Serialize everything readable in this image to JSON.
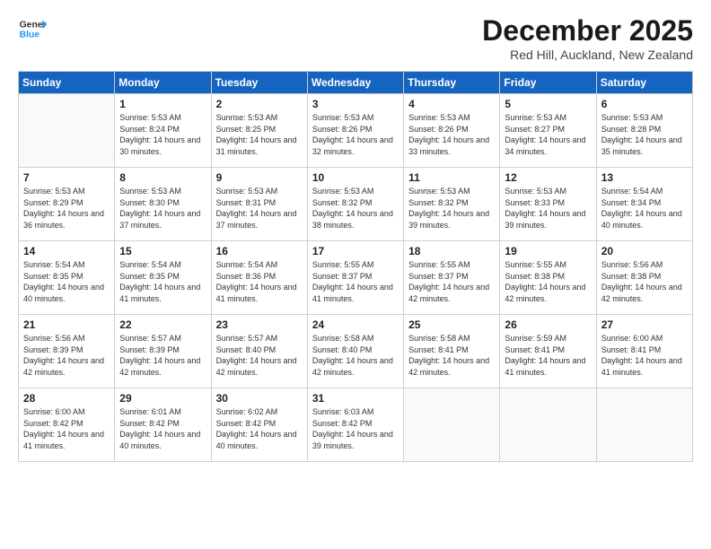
{
  "header": {
    "logo_general": "General",
    "logo_blue": "Blue",
    "month_title": "December 2025",
    "location": "Red Hill, Auckland, New Zealand"
  },
  "days_of_week": [
    "Sunday",
    "Monday",
    "Tuesday",
    "Wednesday",
    "Thursday",
    "Friday",
    "Saturday"
  ],
  "weeks": [
    [
      {
        "day": "",
        "info": "",
        "empty": true
      },
      {
        "day": "1",
        "info": "Sunrise: 5:53 AM\nSunset: 8:24 PM\nDaylight: 14 hours\nand 30 minutes."
      },
      {
        "day": "2",
        "info": "Sunrise: 5:53 AM\nSunset: 8:25 PM\nDaylight: 14 hours\nand 31 minutes."
      },
      {
        "day": "3",
        "info": "Sunrise: 5:53 AM\nSunset: 8:26 PM\nDaylight: 14 hours\nand 32 minutes."
      },
      {
        "day": "4",
        "info": "Sunrise: 5:53 AM\nSunset: 8:26 PM\nDaylight: 14 hours\nand 33 minutes."
      },
      {
        "day": "5",
        "info": "Sunrise: 5:53 AM\nSunset: 8:27 PM\nDaylight: 14 hours\nand 34 minutes."
      },
      {
        "day": "6",
        "info": "Sunrise: 5:53 AM\nSunset: 8:28 PM\nDaylight: 14 hours\nand 35 minutes."
      }
    ],
    [
      {
        "day": "7",
        "info": "Sunrise: 5:53 AM\nSunset: 8:29 PM\nDaylight: 14 hours\nand 36 minutes."
      },
      {
        "day": "8",
        "info": "Sunrise: 5:53 AM\nSunset: 8:30 PM\nDaylight: 14 hours\nand 37 minutes."
      },
      {
        "day": "9",
        "info": "Sunrise: 5:53 AM\nSunset: 8:31 PM\nDaylight: 14 hours\nand 37 minutes."
      },
      {
        "day": "10",
        "info": "Sunrise: 5:53 AM\nSunset: 8:32 PM\nDaylight: 14 hours\nand 38 minutes."
      },
      {
        "day": "11",
        "info": "Sunrise: 5:53 AM\nSunset: 8:32 PM\nDaylight: 14 hours\nand 39 minutes."
      },
      {
        "day": "12",
        "info": "Sunrise: 5:53 AM\nSunset: 8:33 PM\nDaylight: 14 hours\nand 39 minutes."
      },
      {
        "day": "13",
        "info": "Sunrise: 5:54 AM\nSunset: 8:34 PM\nDaylight: 14 hours\nand 40 minutes."
      }
    ],
    [
      {
        "day": "14",
        "info": "Sunrise: 5:54 AM\nSunset: 8:35 PM\nDaylight: 14 hours\nand 40 minutes."
      },
      {
        "day": "15",
        "info": "Sunrise: 5:54 AM\nSunset: 8:35 PM\nDaylight: 14 hours\nand 41 minutes."
      },
      {
        "day": "16",
        "info": "Sunrise: 5:54 AM\nSunset: 8:36 PM\nDaylight: 14 hours\nand 41 minutes."
      },
      {
        "day": "17",
        "info": "Sunrise: 5:55 AM\nSunset: 8:37 PM\nDaylight: 14 hours\nand 41 minutes."
      },
      {
        "day": "18",
        "info": "Sunrise: 5:55 AM\nSunset: 8:37 PM\nDaylight: 14 hours\nand 42 minutes."
      },
      {
        "day": "19",
        "info": "Sunrise: 5:55 AM\nSunset: 8:38 PM\nDaylight: 14 hours\nand 42 minutes."
      },
      {
        "day": "20",
        "info": "Sunrise: 5:56 AM\nSunset: 8:38 PM\nDaylight: 14 hours\nand 42 minutes."
      }
    ],
    [
      {
        "day": "21",
        "info": "Sunrise: 5:56 AM\nSunset: 8:39 PM\nDaylight: 14 hours\nand 42 minutes."
      },
      {
        "day": "22",
        "info": "Sunrise: 5:57 AM\nSunset: 8:39 PM\nDaylight: 14 hours\nand 42 minutes."
      },
      {
        "day": "23",
        "info": "Sunrise: 5:57 AM\nSunset: 8:40 PM\nDaylight: 14 hours\nand 42 minutes."
      },
      {
        "day": "24",
        "info": "Sunrise: 5:58 AM\nSunset: 8:40 PM\nDaylight: 14 hours\nand 42 minutes."
      },
      {
        "day": "25",
        "info": "Sunrise: 5:58 AM\nSunset: 8:41 PM\nDaylight: 14 hours\nand 42 minutes."
      },
      {
        "day": "26",
        "info": "Sunrise: 5:59 AM\nSunset: 8:41 PM\nDaylight: 14 hours\nand 41 minutes."
      },
      {
        "day": "27",
        "info": "Sunrise: 6:00 AM\nSunset: 8:41 PM\nDaylight: 14 hours\nand 41 minutes."
      }
    ],
    [
      {
        "day": "28",
        "info": "Sunrise: 6:00 AM\nSunset: 8:42 PM\nDaylight: 14 hours\nand 41 minutes."
      },
      {
        "day": "29",
        "info": "Sunrise: 6:01 AM\nSunset: 8:42 PM\nDaylight: 14 hours\nand 40 minutes."
      },
      {
        "day": "30",
        "info": "Sunrise: 6:02 AM\nSunset: 8:42 PM\nDaylight: 14 hours\nand 40 minutes."
      },
      {
        "day": "31",
        "info": "Sunrise: 6:03 AM\nSunset: 8:42 PM\nDaylight: 14 hours\nand 39 minutes."
      },
      {
        "day": "",
        "info": "",
        "empty": true
      },
      {
        "day": "",
        "info": "",
        "empty": true
      },
      {
        "day": "",
        "info": "",
        "empty": true
      }
    ]
  ]
}
